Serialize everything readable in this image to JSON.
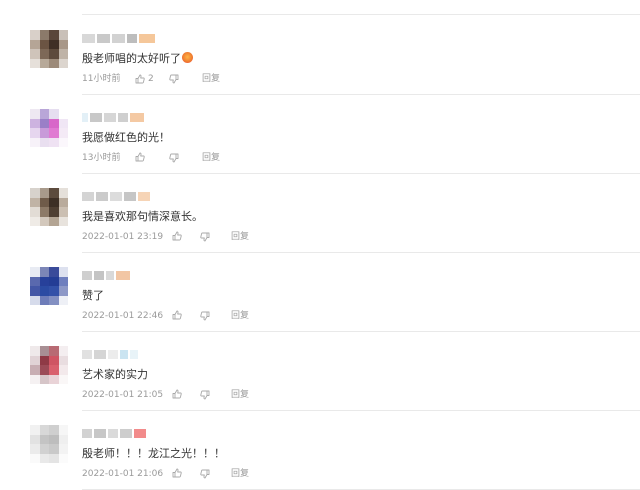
{
  "comments": [
    {
      "text": "殷老师唱的太好听了",
      "has_emoji": true,
      "emoji_icon": "heart-face-emoji-icon",
      "time": "11小时前",
      "like_count": "2",
      "reply_label": "回复",
      "avatar_colors": [
        "#d9d0c9",
        "#8b7a6a",
        "#5a463a",
        "#c9c0b8",
        "#b5a596",
        "#6b5443",
        "#3f2f26",
        "#a89788",
        "#cfc4ba",
        "#7d6857",
        "#5d4a3c",
        "#bfb3a7",
        "#e6e0da",
        "#b7a999",
        "#9c8a79",
        "#dcd5ce"
      ],
      "username_colors": [
        "#d8d8d8",
        "#c9c9c9",
        "#d2d2d2",
        "#bdbdbd",
        "#f5c79a"
      ]
    },
    {
      "text": "我愿做红色的光！",
      "has_emoji": false,
      "time": "13小时前",
      "like_count": "",
      "reply_label": "回复",
      "avatar_colors": [
        "#eee8f2",
        "#b9a6d8",
        "#e6def0",
        "#ffffff",
        "#cdb3e0",
        "#9a7fc7",
        "#d867c9",
        "#f0e6f5",
        "#e6d6ef",
        "#c89ad9",
        "#e07ad2",
        "#f4eaf6",
        "#f7f2f9",
        "#e9dff0",
        "#efe2f3",
        "#fbf7fc"
      ],
      "username_colors": [
        "#e3f0f7",
        "#c8c8c8",
        "#d6d6d6",
        "#cfcfcf",
        "#f4c9a3"
      ]
    },
    {
      "text": "我是喜欢那句情深意长。",
      "has_emoji": false,
      "time": "2022-01-01 23:19",
      "like_count": "",
      "reply_label": "回复",
      "avatar_colors": [
        "#d7d2cc",
        "#a89a8b",
        "#5c4b3d",
        "#e5e0da",
        "#c0b3a5",
        "#6f5b49",
        "#3d2f25",
        "#b9ab9c",
        "#e2dcd5",
        "#8d7a67",
        "#4f3f32",
        "#cbbfb2",
        "#efebe6",
        "#d3c8bc",
        "#b3a493",
        "#e8e3dd"
      ],
      "username_colors": [
        "#d4d4d4",
        "#cbcbcb",
        "#dcdcdc",
        "#c6c6c6",
        "#f6d4b6"
      ]
    },
    {
      "text": "赞了",
      "has_emoji": false,
      "time": "2022-01-01 22:46",
      "like_count": "",
      "reply_label": "回复",
      "avatar_colors": [
        "#e8ebf3",
        "#7c86b7",
        "#3a4b9a",
        "#dde1ef",
        "#5a69ae",
        "#27409a",
        "#243d95",
        "#6f7fbe",
        "#4457a6",
        "#2b4ba3",
        "#3351a8",
        "#8d98c7",
        "#d6dbeb",
        "#6e7db9",
        "#8390c2",
        "#eef0f6"
      ],
      "username_colors": [
        "#cfcfcf",
        "#c4c4c4",
        "#d9d9d9",
        "#f2c6a4"
      ]
    },
    {
      "text": "艺术家的实力",
      "has_emoji": false,
      "time": "2022-01-01 21:05",
      "like_count": "",
      "reply_label": "回复",
      "avatar_colors": [
        "#efe9ea",
        "#a88f94",
        "#b86a73",
        "#f4eef0",
        "#e1d3d6",
        "#8f3a46",
        "#cf5563",
        "#e9dde0",
        "#c8aeb3",
        "#9b4b57",
        "#d9606d",
        "#f3e9eb",
        "#f5f1f2",
        "#d6c5c8",
        "#e9d3d7",
        "#faf7f7"
      ],
      "username_colors": [
        "#e1e1e1",
        "#d5d5d5",
        "#ececec",
        "#cbe4f1",
        "#e8f3f8"
      ]
    },
    {
      "text": "殷老师！！！龙江之光！！！",
      "has_emoji": false,
      "time": "2022-01-01 21:06",
      "like_count": "",
      "reply_label": "回复",
      "avatar_colors": [
        "#f1f1f1",
        "#d8d8d8",
        "#cfcfcf",
        "#f6f6f6",
        "#e2e2e2",
        "#c4c4c4",
        "#bdbdbd",
        "#efefef",
        "#ebebeb",
        "#d1d1d1",
        "#c9c9c9",
        "#f3f3f3",
        "#fafafa",
        "#e9e9e9",
        "#e4e4e4",
        "#fbfbfb"
      ],
      "username_colors": [
        "#d2d2d2",
        "#c7c7c7",
        "#dadada",
        "#cdcdcd",
        "#f28b8b"
      ]
    }
  ],
  "icons": {
    "like": "thumbs-up-icon",
    "dislike": "thumbs-down-icon"
  }
}
